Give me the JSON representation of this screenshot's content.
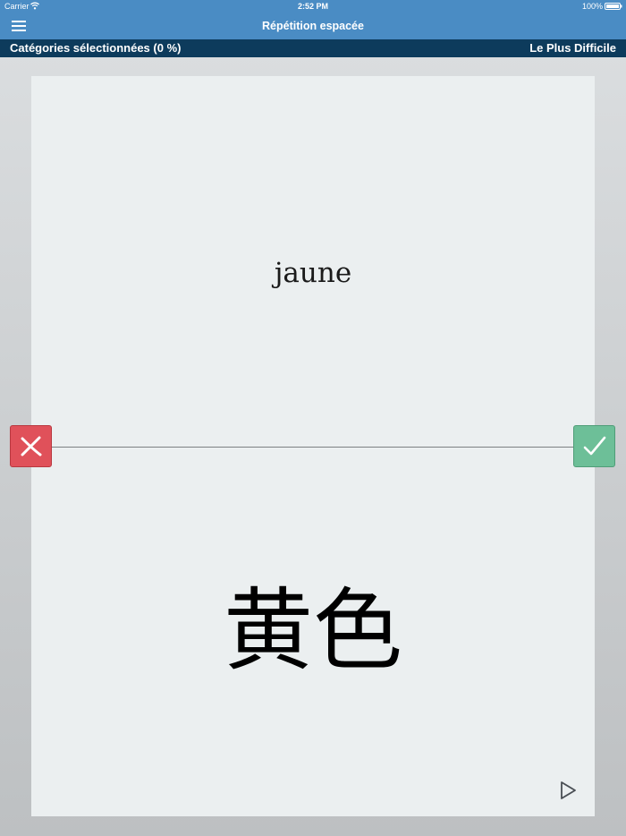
{
  "status_bar": {
    "carrier": "Carrier",
    "time": "2:52 PM",
    "battery": "100%"
  },
  "nav": {
    "title": "Répétition espacée",
    "menu_icon": "hamburger-menu-icon"
  },
  "sub_bar": {
    "categories": "Catégories sélectionnées (0 %)",
    "difficulty": "Le Plus Difficile"
  },
  "card": {
    "front": "jaune",
    "back": "黄色"
  },
  "actions": {
    "wrong_icon": "cross-icon",
    "right_icon": "checkmark-icon",
    "play_icon": "play-icon"
  },
  "colors": {
    "nav_bar": "#4a8cc4",
    "sub_bar": "#0d3b5c",
    "wrong": "#e0515a",
    "right": "#6dbf98",
    "card": "#ebeff0"
  }
}
